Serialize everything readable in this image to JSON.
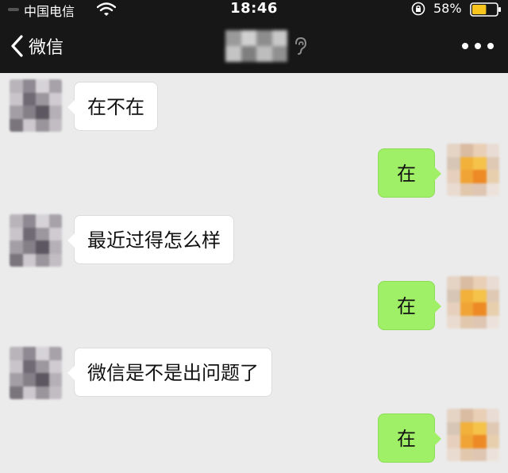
{
  "status_bar": {
    "carrier": "中国电信",
    "time": "18:46",
    "battery_percent": "58%",
    "battery_level": 0.58,
    "icons": [
      "signal-icon",
      "wifi-icon",
      "orientation-lock-icon",
      "battery-icon"
    ]
  },
  "nav": {
    "back_label": "微信",
    "contact_name_blurred": true,
    "icons": [
      "chevron-left-icon",
      "ear-icon",
      "more-icon"
    ]
  },
  "colors": {
    "header_bg": "#171717",
    "chat_bg": "#ebebeb",
    "incoming_bubble": "#ffffff",
    "outgoing_bubble": "#9ff067",
    "battery_fill": "#f7c51e"
  },
  "messages": [
    {
      "direction": "incoming",
      "text": "在不在"
    },
    {
      "direction": "outgoing",
      "text": "在"
    },
    {
      "direction": "incoming",
      "text": "最近过得怎么样"
    },
    {
      "direction": "outgoing",
      "text": "在"
    },
    {
      "direction": "incoming",
      "text": "微信是不是出问题了"
    },
    {
      "direction": "outgoing",
      "text": "在"
    }
  ]
}
